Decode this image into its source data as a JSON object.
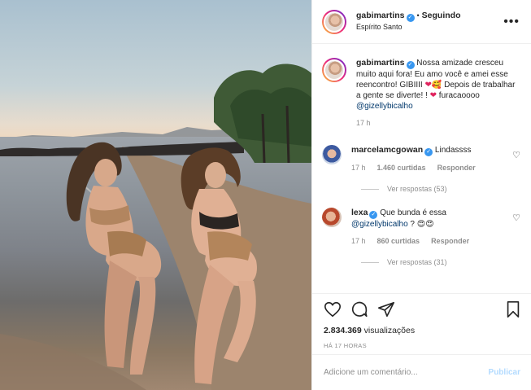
{
  "header": {
    "username": "gabimartins",
    "separator": "•",
    "follow_label": "Seguindo",
    "location": "Espírito Santo",
    "more_label": "•••"
  },
  "caption": {
    "username": "gabimartins",
    "text": "Nossa amizade cresceu muito aqui fora! Eu amo você e amei esse reencontro! GIBIIII",
    "text2": "Depois de trabalhar a gente se diverte! !",
    "text3": "furacaoooo",
    "mention": "@gizellybicalho",
    "time": "17 h"
  },
  "comments": [
    {
      "username": "marcelamcgowan",
      "text": "Lindassss",
      "time": "17 h",
      "likes": "1.460 curtidas",
      "reply_label": "Responder",
      "view_replies": "Ver respostas (53)"
    },
    {
      "username": "lexa",
      "text": "Que bunda é essa",
      "mention": "@gizellybicalho",
      "text_after": "?",
      "time": "17 h",
      "likes": "860 curtidas",
      "reply_label": "Responder",
      "view_replies": "Ver respostas (31)"
    }
  ],
  "post": {
    "views_count": "2.834.369",
    "views_label": "visualizações",
    "timestamp": "HÁ 17 HORAS"
  },
  "add_comment": {
    "placeholder": "Adicione um comentário...",
    "post_label": "Publicar"
  },
  "emoji": {
    "heart": "❤",
    "smile_hearts": "🥰",
    "heart_eyes": "😍",
    "verified": "✓"
  },
  "colors": {
    "verified": "#3897f0",
    "mention": "#00376b",
    "muted": "#8e8e8e",
    "publish": "#b3dbff"
  }
}
